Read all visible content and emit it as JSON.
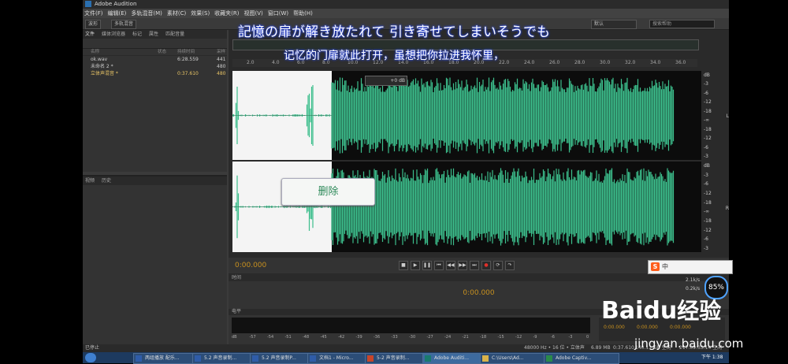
{
  "window": {
    "title": "Adobe Audition"
  },
  "menu": [
    "文件(F)",
    "编辑(E)",
    "多轨混音(M)",
    "素材(C)",
    "效果(S)",
    "收藏夹(R)",
    "视图(V)",
    "窗口(W)",
    "帮助(H)"
  ],
  "toolbar": {
    "waveform": "波形",
    "multitrack": "多轨混音",
    "workspace": "默认",
    "search_placeholder": "搜索帮助"
  },
  "files_panel": {
    "tabs": [
      "文件",
      "媒体浏览器",
      "标记",
      "属性",
      "匹配音量"
    ],
    "columns": [
      "名称",
      "状态",
      "持续时间",
      "采样"
    ],
    "rows": [
      {
        "name": "ok.wav",
        "status": "",
        "duration": "6:28.559",
        "rate": "441"
      },
      {
        "name": "未命名 2 *",
        "status": "",
        "duration": "",
        "rate": "480"
      },
      {
        "name": "立体声混音 *",
        "status": "",
        "duration": "0:37.610",
        "rate": "480"
      }
    ]
  },
  "history_panel": {
    "tabs": [
      "视频",
      "历史"
    ]
  },
  "editor": {
    "ruler": [
      "2.0",
      "4.0",
      "6.0",
      "8.0",
      "10.0",
      "12.0",
      "14.0",
      "16.0",
      "18.0",
      "20.0",
      "22.0",
      "24.0",
      "26.0",
      "28.0",
      "30.0",
      "32.0",
      "34.0",
      "36.0"
    ],
    "db_scale_top": [
      "dB",
      "-3",
      "-6",
      "-12",
      "-18",
      "-∞",
      "-18",
      "-12",
      "-6",
      "-3"
    ],
    "db_scale_bottom": [
      "dB",
      "-3",
      "-6",
      "-12",
      "-18",
      "-∞",
      "-18",
      "-12",
      "-6",
      "-3"
    ],
    "hud": "+0 dB",
    "channel_l": "L",
    "channel_r": "R",
    "timecode": "0:00.000",
    "delete_popup": "删除"
  },
  "time_panel": {
    "title": "时间",
    "timecode": "0:00.000"
  },
  "levels_panel": {
    "title": "电平",
    "scale": [
      "dB",
      "-57",
      "-54",
      "-51",
      "-48",
      "-45",
      "-42",
      "-39",
      "-36",
      "-33",
      "-30",
      "-27",
      "-24",
      "-21",
      "-18",
      "-15",
      "-12",
      "-9",
      "-6",
      "-3",
      "0"
    ]
  },
  "selection": {
    "start": "0:00.000",
    "end": "0:00.000",
    "dur": "0:00.000"
  },
  "status_bar": {
    "left": "已停止",
    "rate": "48000 Hz • 16 位 • 立体声",
    "size": "6.89 MB",
    "duration": "0:37.610",
    "disk": "140.11 GB 空闲",
    "free": "217:09:33.14 空闲"
  },
  "taskbar": [
    {
      "label": "两组播放 配乐..."
    },
    {
      "label": "5.2 声音录制..."
    },
    {
      "label": "5.2 声音录制P..."
    },
    {
      "label": "文档1 - Micro..."
    },
    {
      "label": "5-2 声音录制..."
    },
    {
      "label": "Adobe Auditi..."
    },
    {
      "label": "C:\\Users\\Ad..."
    },
    {
      "label": "Adobe Captiv..."
    }
  ],
  "clock": {
    "time": "下午 1:38"
  },
  "subtitles": {
    "jp": "記憶の扉が解き放たれて 引き寄せてしまいそうでも",
    "cn": "记忆的门扉就此打开，虽想把你拉进我怀里，"
  },
  "ime": {
    "logo": "S",
    "text": "中"
  },
  "net_widget": {
    "percent": "85%",
    "up": "2.1k/s",
    "down": "0.2k/s"
  },
  "watermark": {
    "brand": "Baidu",
    "product": "经验",
    "url": "jingyan.baidu.com"
  },
  "colors": {
    "waveform": "#3cbe8c",
    "timecode": "#c7901f",
    "selection_bg": "#f4f4f4"
  }
}
